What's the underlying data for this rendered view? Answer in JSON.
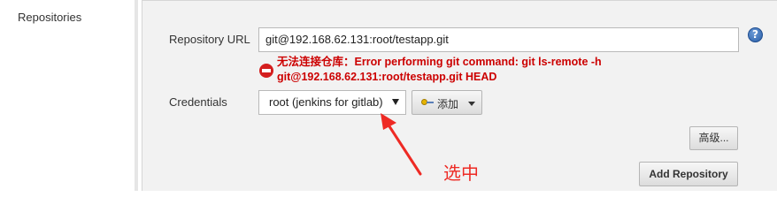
{
  "section": {
    "label": "Repositories"
  },
  "repository_url": {
    "label": "Repository URL",
    "value": "git@192.168.62.131:root/testapp.git"
  },
  "help": {
    "symbol": "?"
  },
  "error": {
    "line1": "无法连接仓库：Error performing git command: git ls-remote -h",
    "line2": "git@192.168.62.131:root/testapp.git HEAD",
    "color": "#cc0000"
  },
  "credentials": {
    "label": "Credentials",
    "selected": "root (jenkins for gitlab)",
    "add_label": "添加"
  },
  "buttons": {
    "advanced": "高级...",
    "add_repository": "Add Repository"
  },
  "annotation": {
    "text": "选中",
    "color": "#ee2a24"
  }
}
